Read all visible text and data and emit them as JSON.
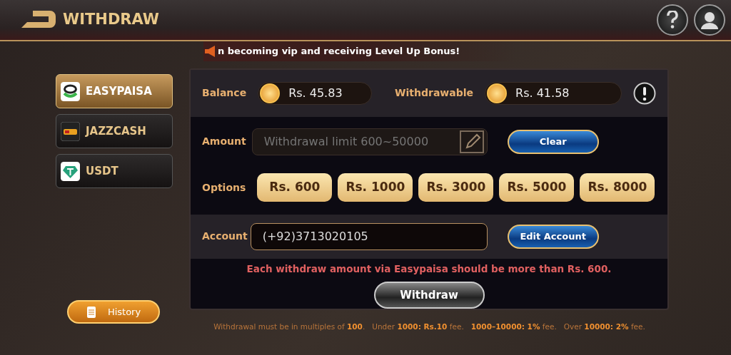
{
  "header": {
    "title": "WITHDRAW"
  },
  "marquee": "n becoming vip and receiving Level Up Bonus!",
  "methods": [
    {
      "label": "EASYPAISA",
      "kind": "easypaisa",
      "selected": true
    },
    {
      "label": "JAZZCASH",
      "kind": "jazzcash",
      "selected": false
    },
    {
      "label": "USDT",
      "kind": "usdt",
      "selected": false
    }
  ],
  "history_button": "History",
  "balance": {
    "label": "Balance",
    "value": "Rs. 45.83"
  },
  "withdrawable": {
    "label": "Withdrawable",
    "value": "Rs. 41.58"
  },
  "amount": {
    "label": "Amount",
    "placeholder": "Withdrawal limit 600~50000",
    "clear_button": "Clear"
  },
  "options": {
    "label": "Options",
    "items": [
      "Rs. 600",
      "Rs. 1000",
      "Rs. 3000",
      "Rs. 5000",
      "Rs. 8000"
    ]
  },
  "account": {
    "label": "Account",
    "value": "(+92)3713020105",
    "edit_button": "Edit Account"
  },
  "warning": "Each withdraw amount via Easypaisa should be more than Rs. 600.",
  "withdraw_button": "Withdraw",
  "footer_note": "Withdrawal must be in multiples of **100**.   Under **1000: Rs.10** fee.   **1000–10000: 1%** fee.   Over **10000: 2%** fee."
}
